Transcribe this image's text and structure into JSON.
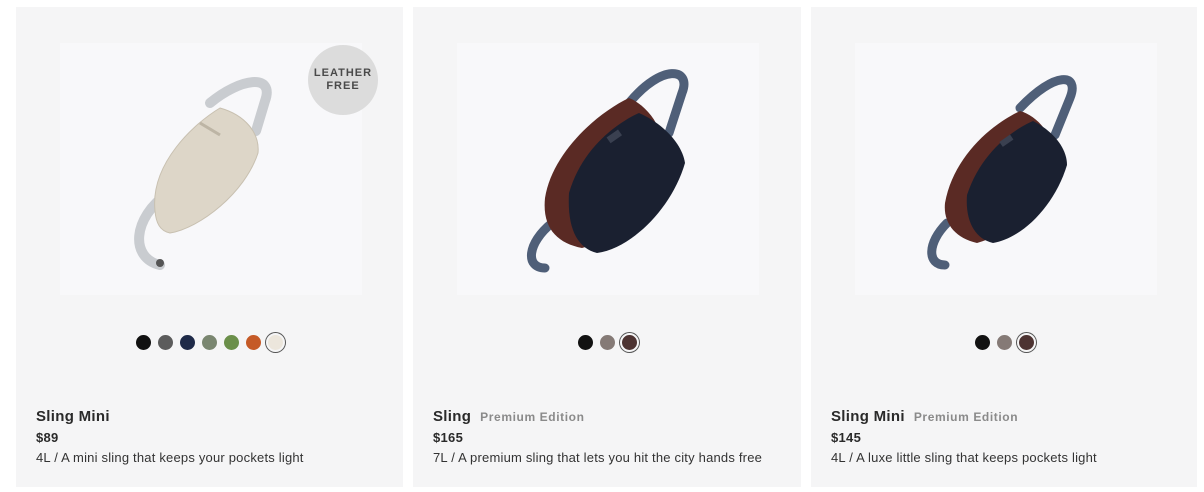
{
  "products": [
    {
      "name": "Sling Mini",
      "edition": "",
      "price": "$89",
      "description": "4L / A mini sling that keeps your pockets light",
      "badge": {
        "line1": "LEATHER",
        "line2": "FREE"
      },
      "image": {
        "icon": "bag-sling-mini-stone-image",
        "body_color": "#ddd6c8",
        "strap_color": "#c9ccd0"
      },
      "swatches": [
        "#111111",
        "#5c5c5c",
        "#1e2a48",
        "#7a8670",
        "#6b8f4a",
        "#c55a27",
        "#ece6dc"
      ]
    },
    {
      "name": "Sling",
      "edition": "Premium Edition",
      "price": "$165",
      "description": "7L / A premium sling that lets you hit the city hands free",
      "badge": null,
      "image": {
        "icon": "bag-sling-premium-navy-image",
        "body_color": "#1a2030",
        "strap_color": "#4f5f78"
      },
      "swatches": [
        "#121212",
        "#857a76",
        "#4d3332"
      ]
    },
    {
      "name": "Sling Mini",
      "edition": "Premium Edition",
      "price": "$145",
      "description": "4L / A luxe little sling that keeps pockets light",
      "badge": null,
      "image": {
        "icon": "bag-sling-mini-premium-navy-image",
        "body_color": "#1a2030",
        "strap_color": "#4f5f78"
      },
      "swatches": [
        "#121212",
        "#857a76",
        "#4d3332"
      ]
    }
  ]
}
